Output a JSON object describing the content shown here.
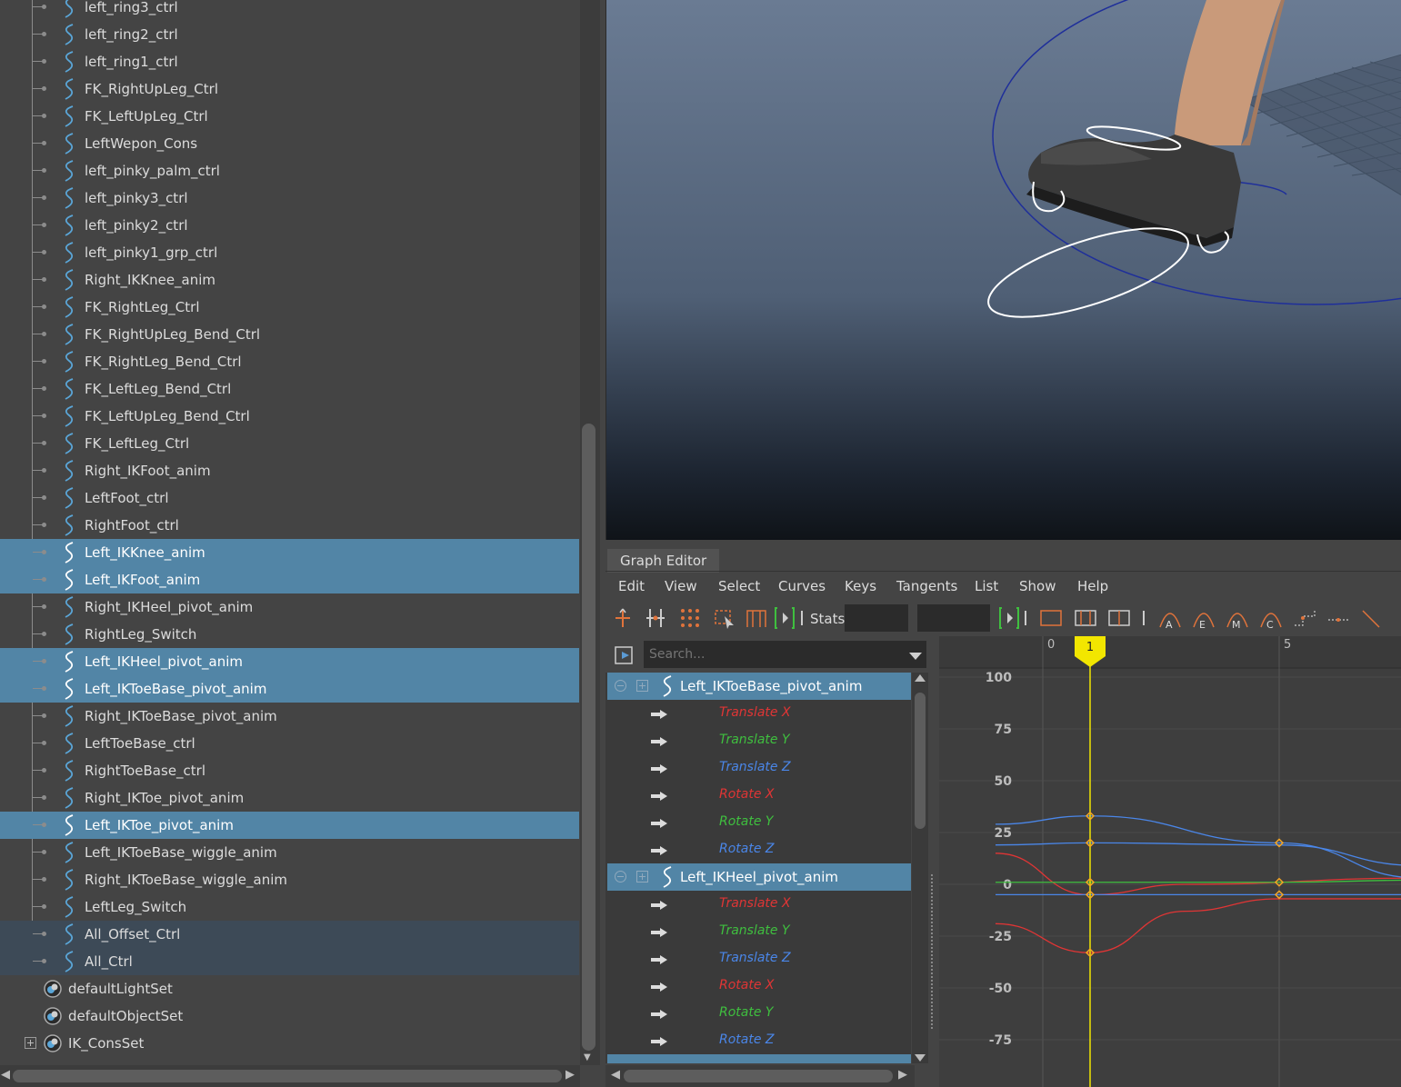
{
  "outliner": {
    "items": [
      {
        "label": "left_ring3_ctrl",
        "state": ""
      },
      {
        "label": "left_ring2_ctrl",
        "state": ""
      },
      {
        "label": "left_ring1_ctrl",
        "state": ""
      },
      {
        "label": "FK_RightUpLeg_Ctrl",
        "state": ""
      },
      {
        "label": "FK_LeftUpLeg_Ctrl",
        "state": ""
      },
      {
        "label": "LeftWepon_Cons",
        "state": ""
      },
      {
        "label": "left_pinky_palm_ctrl",
        "state": ""
      },
      {
        "label": "left_pinky3_ctrl",
        "state": ""
      },
      {
        "label": "left_pinky2_ctrl",
        "state": ""
      },
      {
        "label": "left_pinky1_grp_ctrl",
        "state": ""
      },
      {
        "label": "Right_IKKnee_anim",
        "state": ""
      },
      {
        "label": "FK_RightLeg_Ctrl",
        "state": ""
      },
      {
        "label": "FK_RightUpLeg_Bend_Ctrl",
        "state": ""
      },
      {
        "label": "FK_RightLeg_Bend_Ctrl",
        "state": ""
      },
      {
        "label": "FK_LeftLeg_Bend_Ctrl",
        "state": ""
      },
      {
        "label": "FK_LeftUpLeg_Bend_Ctrl",
        "state": ""
      },
      {
        "label": "FK_LeftLeg_Ctrl",
        "state": ""
      },
      {
        "label": "Right_IKFoot_anim",
        "state": ""
      },
      {
        "label": "LeftFoot_ctrl",
        "state": ""
      },
      {
        "label": "RightFoot_ctrl",
        "state": ""
      },
      {
        "label": "Left_IKKnee_anim",
        "state": "selected"
      },
      {
        "label": "Left_IKFoot_anim",
        "state": "selected"
      },
      {
        "label": "Right_IKHeel_pivot_anim",
        "state": ""
      },
      {
        "label": "RightLeg_Switch",
        "state": ""
      },
      {
        "label": "Left_IKHeel_pivot_anim",
        "state": "selected"
      },
      {
        "label": "Left_IKToeBase_pivot_anim",
        "state": "selected"
      },
      {
        "label": "Right_IKToeBase_pivot_anim",
        "state": ""
      },
      {
        "label": "LeftToeBase_ctrl",
        "state": ""
      },
      {
        "label": "RightToeBase_ctrl",
        "state": ""
      },
      {
        "label": "Right_IKToe_pivot_anim",
        "state": ""
      },
      {
        "label": "Left_IKToe_pivot_anim",
        "state": "selected"
      },
      {
        "label": "Left_IKToeBase_wiggle_anim",
        "state": ""
      },
      {
        "label": "Right_IKToeBase_wiggle_anim",
        "state": ""
      },
      {
        "label": "LeftLeg_Switch",
        "state": ""
      },
      {
        "label": "All_Offset_Ctrl",
        "state": "parent"
      },
      {
        "label": "All_Ctrl",
        "state": "parent"
      }
    ],
    "sets": [
      {
        "label": "defaultLightSet",
        "expandable": false
      },
      {
        "label": "defaultObjectSet",
        "expandable": false
      },
      {
        "label": "IK_ConsSet",
        "expandable": true
      }
    ]
  },
  "graph_editor": {
    "tab_label": "Graph Editor",
    "menu": [
      "Edit",
      "View",
      "Select",
      "Curves",
      "Keys",
      "Tangents",
      "List",
      "Show",
      "Help"
    ],
    "stats_label": "Stats",
    "stats_values": [
      "",
      ""
    ],
    "search_placeholder": "Search...",
    "toolbar_icons": [
      "move-key-icon",
      "insert-key-icon",
      "lattice-deform-icon",
      "region-select-icon",
      "retime-tool-icon",
      "frame-bracket-icon",
      "frame-bracket-icon",
      "buffer-curve-icon",
      "normalize-icon",
      "denormalize-icon",
      "auto-tangent-icon",
      "spline-tangent-icon",
      "clamped-tangent-icon",
      "plateau-tangent-icon",
      "stepped-tangent-icon",
      "flat-tangent-icon",
      "linear-tangent-icon"
    ],
    "tangent_letters": [
      "A",
      "E",
      "M",
      "C"
    ],
    "nodes": [
      {
        "label": "Left_IKToeBase_pivot_anim",
        "attributes": [
          {
            "label": "Translate X",
            "color": "#e03535"
          },
          {
            "label": "Translate Y",
            "color": "#3fbf3f"
          },
          {
            "label": "Translate Z",
            "color": "#4a86e8"
          },
          {
            "label": "Rotate X",
            "color": "#e03535"
          },
          {
            "label": "Rotate Y",
            "color": "#3fbf3f"
          },
          {
            "label": "Rotate Z",
            "color": "#4a86e8"
          }
        ]
      },
      {
        "label": "Left_IKHeel_pivot_anim",
        "attributes": [
          {
            "label": "Translate X",
            "color": "#e03535"
          },
          {
            "label": "Translate Y",
            "color": "#3fbf3f"
          },
          {
            "label": "Translate Z",
            "color": "#4a86e8"
          },
          {
            "label": "Rotate X",
            "color": "#e03535"
          },
          {
            "label": "Rotate Y",
            "color": "#3fbf3f"
          },
          {
            "label": "Rotate Z",
            "color": "#4a86e8"
          }
        ]
      }
    ],
    "plot": {
      "frame_ticks": [
        "0",
        "5"
      ],
      "current_frame": "1",
      "value_ticks": [
        "100",
        "75",
        "50",
        "25",
        "0",
        "-25",
        "-50",
        "-75"
      ],
      "curves": [
        {
          "color": "#4a86e8",
          "points": [
            [
              -1,
              29
            ],
            [
              1,
              33
            ],
            [
              5,
              20
            ],
            [
              8,
              3
            ]
          ]
        },
        {
          "color": "#4a86e8",
          "points": [
            [
              -1,
              19
            ],
            [
              1,
              20
            ],
            [
              5,
              19
            ],
            [
              8,
              9
            ]
          ]
        },
        {
          "color": "#e03535",
          "points": [
            [
              -1,
              15
            ],
            [
              1,
              -5
            ],
            [
              3,
              0
            ],
            [
              8,
              3
            ]
          ]
        },
        {
          "color": "#e03535",
          "points": [
            [
              -1,
              -19
            ],
            [
              1,
              -33
            ],
            [
              3,
              -13
            ],
            [
              5,
              -7
            ],
            [
              8,
              -7
            ]
          ]
        },
        {
          "color": "#3fbf3f",
          "points": [
            [
              -1,
              1
            ],
            [
              1,
              1
            ],
            [
              5,
              1
            ],
            [
              8,
              2
            ]
          ]
        },
        {
          "color": "#4a86e8",
          "points": [
            [
              -1,
              -5
            ],
            [
              1,
              -5
            ],
            [
              5,
              -5
            ],
            [
              8,
              -5
            ]
          ]
        }
      ],
      "keys": [
        {
          "frame": 1,
          "value": 33
        },
        {
          "frame": 1,
          "value": 20
        },
        {
          "frame": 1,
          "value": 1
        },
        {
          "frame": 1,
          "value": -5
        },
        {
          "frame": 1,
          "value": -33
        },
        {
          "frame": 5,
          "value": 20
        },
        {
          "frame": 5,
          "value": 1
        },
        {
          "frame": 5,
          "value": -5
        }
      ]
    }
  },
  "colors": {
    "selection": "#5285a6",
    "accent_key": "#f5a623",
    "current_time": "#f2e600"
  }
}
